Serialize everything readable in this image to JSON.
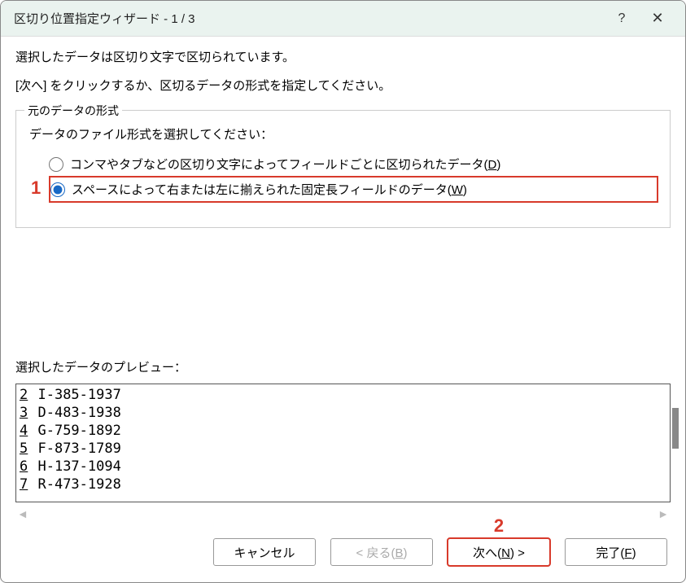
{
  "title": "区切り位置指定ウィザード - 1 / 3",
  "help_symbol": "?",
  "close_symbol": "✕",
  "intro1": "選択したデータは区切り文字で区切られています。",
  "intro2": "[次へ] をクリックするか、区切るデータの形式を指定してください。",
  "fieldset": {
    "legend": "元のデータの形式",
    "prompt": "データのファイル形式を選択してください：",
    "option_delimited": {
      "label": "コンマやタブなどの区切り文字によってフィールドごとに区切られたデータ(",
      "accel": "D",
      "tail": ")"
    },
    "option_fixed": {
      "label": "スペースによって右または左に揃えられた固定長フィールドのデータ(",
      "accel": "W",
      "tail": ")"
    }
  },
  "preview_label": "選択したデータのプレビュー：",
  "preview_rows": [
    {
      "n": "2",
      "t": "I-385-1937"
    },
    {
      "n": "3",
      "t": "D-483-1938"
    },
    {
      "n": "4",
      "t": "G-759-1892"
    },
    {
      "n": "5",
      "t": "F-873-1789"
    },
    {
      "n": "6",
      "t": "H-137-1094"
    },
    {
      "n": "7",
      "t": "R-473-1928"
    }
  ],
  "scroll": {
    "left": "◄",
    "right": "►"
  },
  "buttons": {
    "cancel": "キャンセル",
    "back": {
      "pre": "< 戻る(",
      "accel": "B",
      "post": ")"
    },
    "next": {
      "pre": "次へ(",
      "accel": "N",
      "post": ") >"
    },
    "finish": {
      "pre": "完了(",
      "accel": "F",
      "post": ")"
    }
  },
  "callouts": {
    "one": "1",
    "two": "2"
  }
}
